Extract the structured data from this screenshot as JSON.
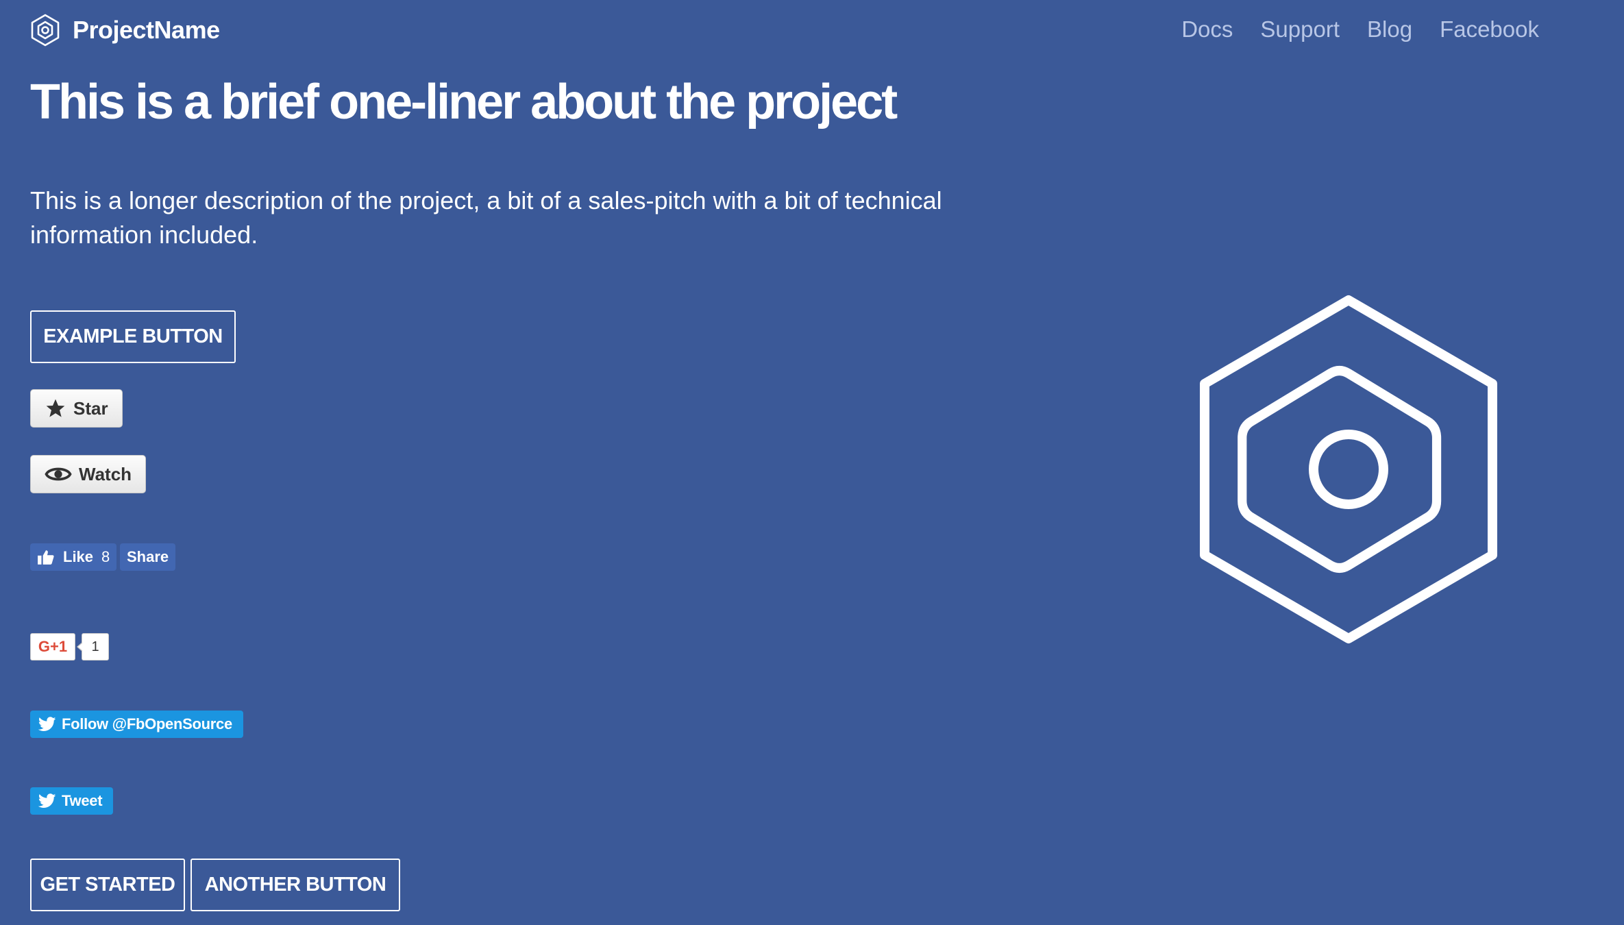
{
  "header": {
    "brand": "ProjectName",
    "nav": [
      {
        "label": "Docs"
      },
      {
        "label": "Support"
      },
      {
        "label": "Blog"
      },
      {
        "label": "Facebook"
      }
    ]
  },
  "hero": {
    "headline": "This is a brief one-liner about the project",
    "description": "This is a longer description of the project, a bit of a sales-pitch with a bit of technical information included.",
    "example_button": "EXAMPLE BUTTON",
    "logo_icon": "hexagon-nut-icon"
  },
  "github": {
    "star_label": "Star",
    "star_icon": "star-icon",
    "watch_label": "Watch",
    "watch_icon": "eye-icon"
  },
  "facebook": {
    "like_label": "Like",
    "like_count": "8",
    "share_label": "Share",
    "like_icon": "thumbs-up-icon"
  },
  "google": {
    "plus_label": "G+1",
    "plus_count": "1"
  },
  "twitter": {
    "follow_label": "Follow @FbOpenSource",
    "tweet_label": "Tweet",
    "bird_icon": "twitter-bird-icon"
  },
  "actions": {
    "get_started": "GET STARTED",
    "another_button": "ANOTHER BUTTON"
  },
  "colors": {
    "background": "#3b5998",
    "nav_link": "#b8c6e6",
    "facebook_button": "#4267b2",
    "twitter_button": "#1b95e0",
    "gplus_red": "#dd4b39"
  }
}
